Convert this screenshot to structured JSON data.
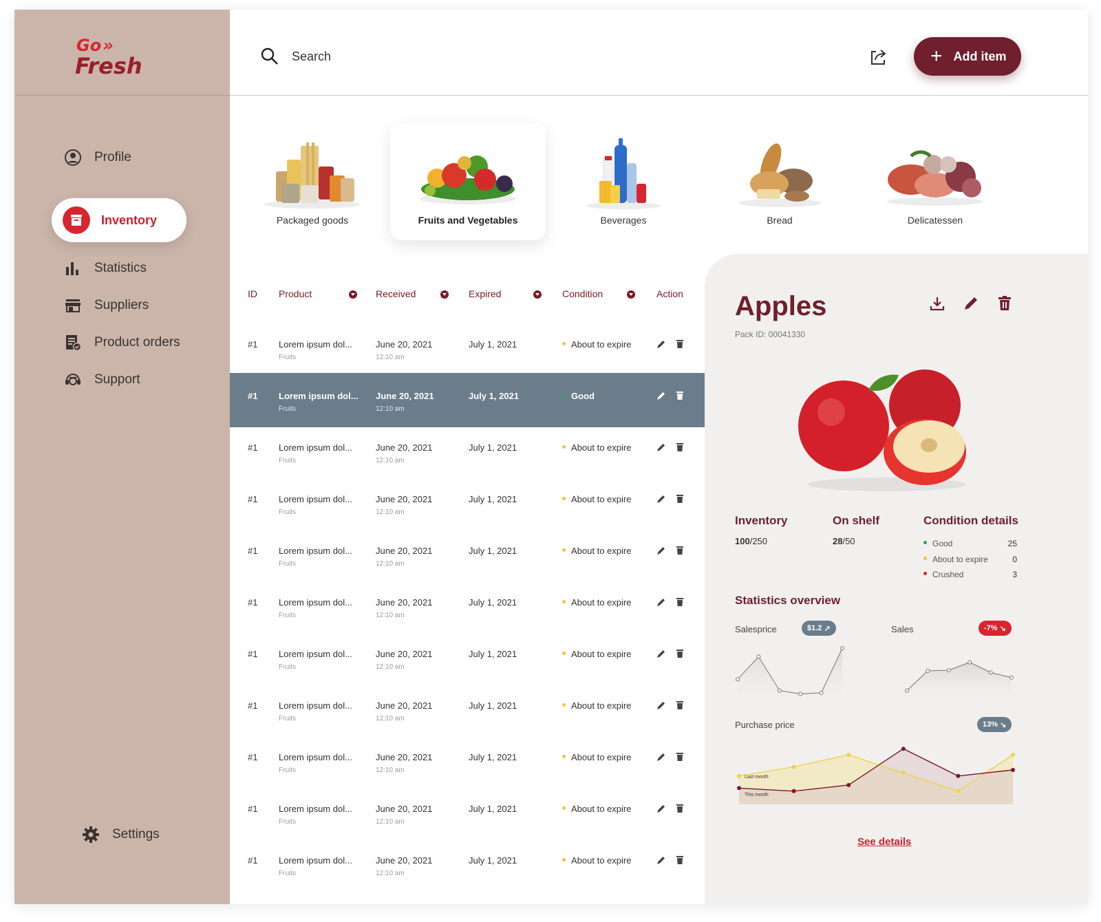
{
  "logo": {
    "line1": "Go",
    "arrows": "»",
    "line2": "Fresh"
  },
  "nav": {
    "items": [
      {
        "label": "Profile",
        "icon": "profile-icon"
      },
      {
        "label": "Inventory",
        "icon": "inventory-icon"
      },
      {
        "label": "Statistics",
        "icon": "bar-chart-icon"
      },
      {
        "label": "Suppliers",
        "icon": "store-icon"
      },
      {
        "label": "Product orders",
        "icon": "order-icon"
      },
      {
        "label": "Support",
        "icon": "support-icon"
      }
    ],
    "active": "Inventory",
    "settings": "Settings"
  },
  "header": {
    "search_placeholder": "Search",
    "add_label": "Add item"
  },
  "categories": [
    "Packaged goods",
    "Fruits and Vegetables",
    "Beverages",
    "Bread",
    "Delicatessen"
  ],
  "selected_category": "Fruits and Vegetables",
  "table": {
    "columns": [
      "ID",
      "Product",
      "Received",
      "Expired",
      "Condition",
      "Action"
    ],
    "rows": [
      {
        "id": "#1",
        "product": "Lorem ipsum dol...",
        "category": "Fruits",
        "received": "June 20, 2021",
        "time": "12:10 am",
        "expired": "July 1, 2021",
        "condition": "About to expire"
      },
      {
        "id": "#1",
        "product": "Lorem ipsum dol...",
        "category": "Fruits",
        "received": "June 20, 2021",
        "time": "12:10 am",
        "expired": "July 1, 2021",
        "condition": "Good"
      },
      {
        "id": "#1",
        "product": "Lorem ipsum dol...",
        "category": "Fruits",
        "received": "June 20, 2021",
        "time": "12:10 am",
        "expired": "July 1, 2021",
        "condition": "About to expire"
      },
      {
        "id": "#1",
        "product": "Lorem ipsum dol...",
        "category": "Fruits",
        "received": "June 20, 2021",
        "time": "12:10 am",
        "expired": "July 1, 2021",
        "condition": "About to expire"
      },
      {
        "id": "#1",
        "product": "Lorem ipsum dol...",
        "category": "Fruits",
        "received": "June 20, 2021",
        "time": "12:10 am",
        "expired": "July 1, 2021",
        "condition": "About to expire"
      },
      {
        "id": "#1",
        "product": "Lorem ipsum dol...",
        "category": "Fruits",
        "received": "June 20, 2021",
        "time": "12:10 am",
        "expired": "July 1, 2021",
        "condition": "About to expire"
      },
      {
        "id": "#1",
        "product": "Lorem ipsum dol...",
        "category": "Fruits",
        "received": "June 20, 2021",
        "time": "12:10 am",
        "expired": "July 1, 2021",
        "condition": "About to expire"
      },
      {
        "id": "#1",
        "product": "Lorem ipsum dol...",
        "category": "Fruits",
        "received": "June 20, 2021",
        "time": "12:10 am",
        "expired": "July 1, 2021",
        "condition": "About to expire"
      },
      {
        "id": "#1",
        "product": "Lorem ipsum dol...",
        "category": "Fruits",
        "received": "June 20, 2021",
        "time": "12:10 am",
        "expired": "July 1, 2021",
        "condition": "About to expire"
      },
      {
        "id": "#1",
        "product": "Lorem ipsum dol...",
        "category": "Fruits",
        "received": "June 20, 2021",
        "time": "12:10 am",
        "expired": "July 1, 2021",
        "condition": "About to expire"
      },
      {
        "id": "#1",
        "product": "Lorem ipsum dol...",
        "category": "Fruits",
        "received": "June 20, 2021",
        "time": "12:10 am",
        "expired": "July 1, 2021",
        "condition": "About to expire"
      }
    ],
    "selected_row": 1
  },
  "detail": {
    "title": "Apples",
    "pack_id": "Pack ID: 00041330",
    "inventory_label": "Inventory",
    "inventory_value": "100",
    "inventory_total": "/250",
    "shelf_label": "On shelf",
    "shelf_value": "28",
    "shelf_total": "/50",
    "condition_label": "Condition details",
    "conditions": [
      {
        "label": "Good",
        "count": "25",
        "color": "#2da84a"
      },
      {
        "label": "About to expire",
        "count": "0",
        "color": "#f0c53a"
      },
      {
        "label": "Crushed",
        "count": "3",
        "color": "#d8252f"
      }
    ],
    "stats_title": "Statistics overview",
    "salesprice_label": "Salesprice",
    "salesprice_pill": "$1.2",
    "sales_label": "Sales",
    "sales_pill": "-7%",
    "purchase_label": "Purchase price",
    "purchase_pill": "13%",
    "last_month": "Last month",
    "this_month": "This month",
    "see_details": "See details"
  },
  "colors": {
    "brand": "#6f1f2d",
    "accent_red": "#d8252f",
    "sidebar": "#cbb5aa",
    "selected_row": "#6b7c8b",
    "panel": "#f1f0ef"
  },
  "chart_data": [
    {
      "type": "line",
      "title": "Salesprice",
      "values": [
        40,
        80,
        20,
        14,
        16,
        95
      ]
    },
    {
      "type": "line",
      "title": "Sales",
      "values": [
        20,
        55,
        56,
        70,
        52,
        43
      ]
    },
    {
      "type": "area",
      "title": "Purchase price",
      "series": [
        {
          "name": "Last month",
          "values": [
            40,
            55,
            75,
            45,
            15,
            75
          ]
        },
        {
          "name": "This month",
          "values": [
            20,
            15,
            25,
            85,
            40,
            50
          ]
        }
      ]
    }
  ]
}
